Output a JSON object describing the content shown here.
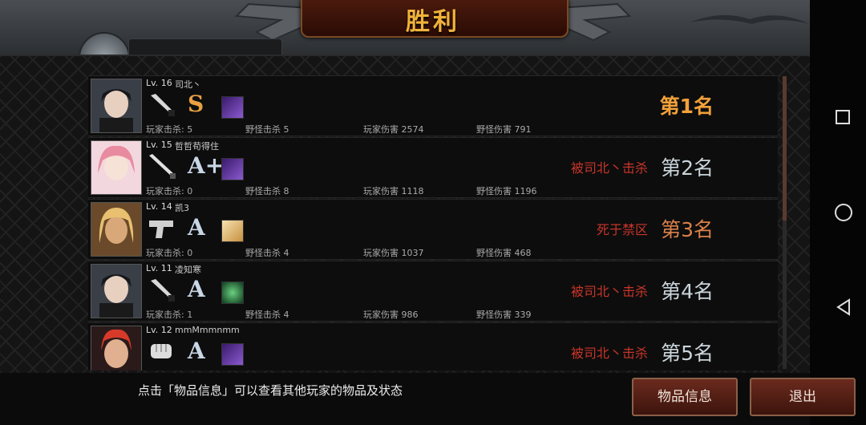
{
  "header": {
    "title": "胜利"
  },
  "hint": "点击「物品信息」可以查看其他玩家的物品及状态",
  "buttons": {
    "item_info": "物品信息",
    "exit": "退出"
  },
  "players": [
    {
      "level": "Lv. 16",
      "name": "司北丶",
      "weapon": "knife-icon",
      "grade": "S",
      "item": "purple-item-icon",
      "player_kills": "玩家击杀: 5",
      "monster_kills": "野怪击杀 5",
      "player_damage": "玩家伤害 2574",
      "monster_damage": "野怪伤害 791",
      "status": "",
      "rank": "第1名"
    },
    {
      "level": "Lv. 15",
      "name": "哲哲苟得住",
      "weapon": "sword-icon",
      "grade": "A+",
      "item": "purple-item-icon",
      "player_kills": "玩家击杀: 0",
      "monster_kills": "野怪击杀 8",
      "player_damage": "玩家伤害 1118",
      "monster_damage": "野怪伤害 1196",
      "status": "被司北丶击杀",
      "rank": "第2名"
    },
    {
      "level": "Lv. 14",
      "name": "凯3",
      "weapon": "pistol-icon",
      "grade": "A",
      "item": "gold-item-icon",
      "player_kills": "玩家击杀: 0",
      "monster_kills": "野怪击杀 4",
      "player_damage": "玩家伤害 1037",
      "monster_damage": "野怪伤害 468",
      "status": "死于禁区",
      "rank": "第3名"
    },
    {
      "level": "Lv. 11",
      "name": "凌知寒",
      "weapon": "knife-icon",
      "grade": "A",
      "item": "green-item-icon",
      "player_kills": "玩家击杀: 1",
      "monster_kills": "野怪击杀 4",
      "player_damage": "玩家伤害 986",
      "monster_damage": "野怪伤害 339",
      "status": "被司北丶击杀",
      "rank": "第4名"
    },
    {
      "level": "Lv. 12",
      "name": "mmMmmnmm",
      "weapon": "fist-icon",
      "grade": "A",
      "item": "purple-item-icon",
      "player_kills": "",
      "monster_kills": "",
      "player_damage": "",
      "monster_damage": "",
      "status": "被司北丶击杀",
      "rank": "第5名"
    }
  ]
}
